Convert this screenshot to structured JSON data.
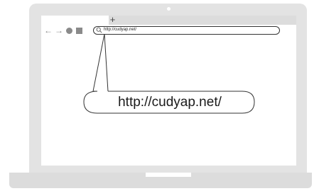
{
  "browser": {
    "new_tab_label": "+",
    "nav": {
      "back_icon": "←",
      "forward_icon": "→"
    },
    "address_bar": {
      "url": "http://cudyap.net/"
    }
  },
  "callout": {
    "text": "http://cudyap.net/"
  },
  "colors": {
    "laptop_body": "#e3e3e3",
    "tab_strip": "#dcdcdc",
    "nav_icons": "#8a8a8a",
    "outline": "#333333"
  }
}
